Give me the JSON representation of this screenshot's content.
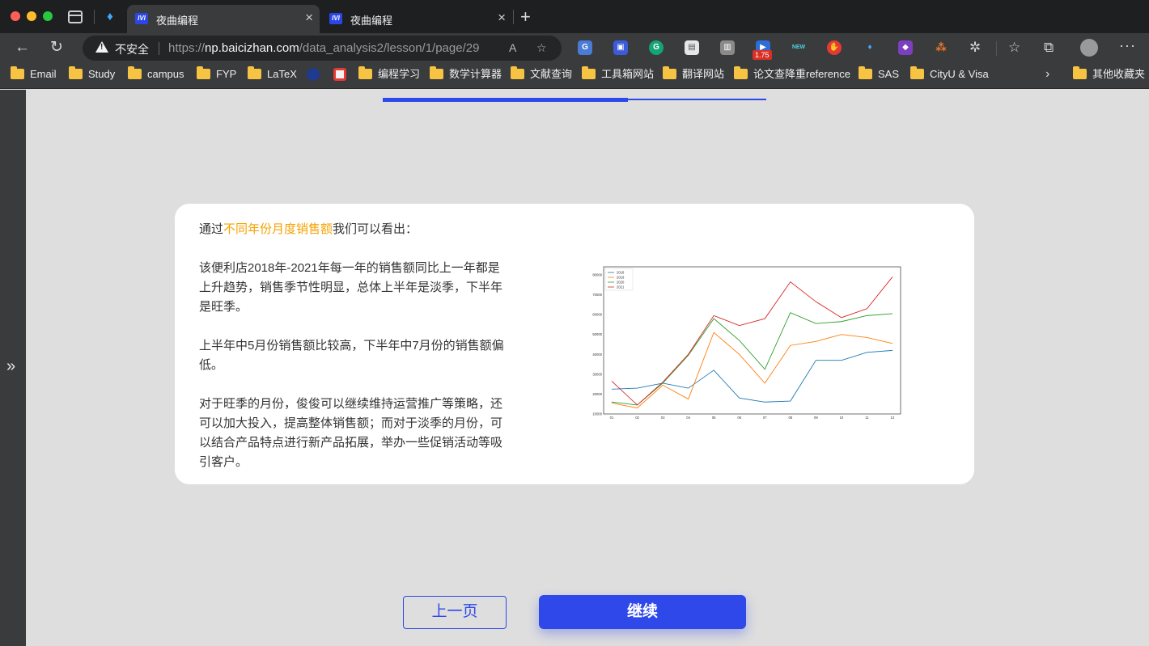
{
  "browser": {
    "tabs": [
      {
        "title": "夜曲编程",
        "favicon": "IVI",
        "active": true
      },
      {
        "title": "夜曲编程",
        "favicon": "IVI",
        "active": false
      }
    ],
    "insecure_label": "不安全",
    "url_prefix": "https://",
    "url_host": "np.baicizhan.com",
    "url_path": "/data_analysis2/lesson/1/page/29",
    "extension_badge": "1.75",
    "extension_new": "NEW",
    "bookmarks": [
      "Email",
      "Study",
      "campus",
      "FYP",
      "LaTeX",
      "编程学习",
      "数学计算器",
      "文献查询",
      "工具箱网站",
      "翻译网站",
      "论文查降重reference",
      "SAS",
      "CityU & Visa"
    ],
    "other_bookmarks": "其他收藏夹"
  },
  "lesson": {
    "progress_fraction": 0.64,
    "intro_prefix": "通过",
    "intro_highlight": "不同年份月度销售额",
    "intro_suffix": "我们可以看出：",
    "para1": "该便利店2018年-2021年每一年的销售额同比上一年都是上升趋势，销售季节性明显，总体上半年是淡季，下半年是旺季。",
    "para2": "上半年中5月份销售额比较高，下半年中7月份的销售额偏低。",
    "para3": "对于旺季的月份，俊俊可以继续维持运营推广等策略，还可以加大投入，提高整体销售额；而对于淡季的月份，可以结合产品特点进行新产品拓展，举办一些促销活动等吸引客户。",
    "prev_button": "上一页",
    "next_button": "继续",
    "accent_color": "#2f48ea",
    "highlight_color": "#f5a200"
  },
  "chart_data": {
    "type": "line",
    "categories": [
      "01",
      "02",
      "03",
      "04",
      "05",
      "06",
      "07",
      "08",
      "09",
      "10",
      "11",
      "12"
    ],
    "ylim": [
      10000,
      80000
    ],
    "yticks": [
      "10000",
      "20000",
      "30000",
      "40000",
      "50000",
      "60000",
      "70000",
      "80000"
    ],
    "legend_position": "top-left",
    "series": [
      {
        "name": "2018",
        "color": "#1f77b4",
        "values": [
          22500,
          23000,
          25500,
          23000,
          32000,
          18000,
          16000,
          16500,
          37000,
          37000,
          41000,
          42000
        ]
      },
      {
        "name": "2019",
        "color": "#ff7f0e",
        "values": [
          15500,
          13000,
          24500,
          17500,
          51000,
          40000,
          25500,
          44500,
          46500,
          50000,
          48500,
          45500
        ]
      },
      {
        "name": "2020",
        "color": "#2ca02c",
        "values": [
          16000,
          14500,
          25500,
          39500,
          58000,
          47000,
          32500,
          61000,
          55500,
          56500,
          59500,
          60500
        ]
      },
      {
        "name": "2021",
        "color": "#d62728",
        "values": [
          26500,
          14500,
          26000,
          40000,
          59500,
          54500,
          58000,
          76500,
          66500,
          58500,
          63000,
          79000
        ]
      }
    ]
  }
}
